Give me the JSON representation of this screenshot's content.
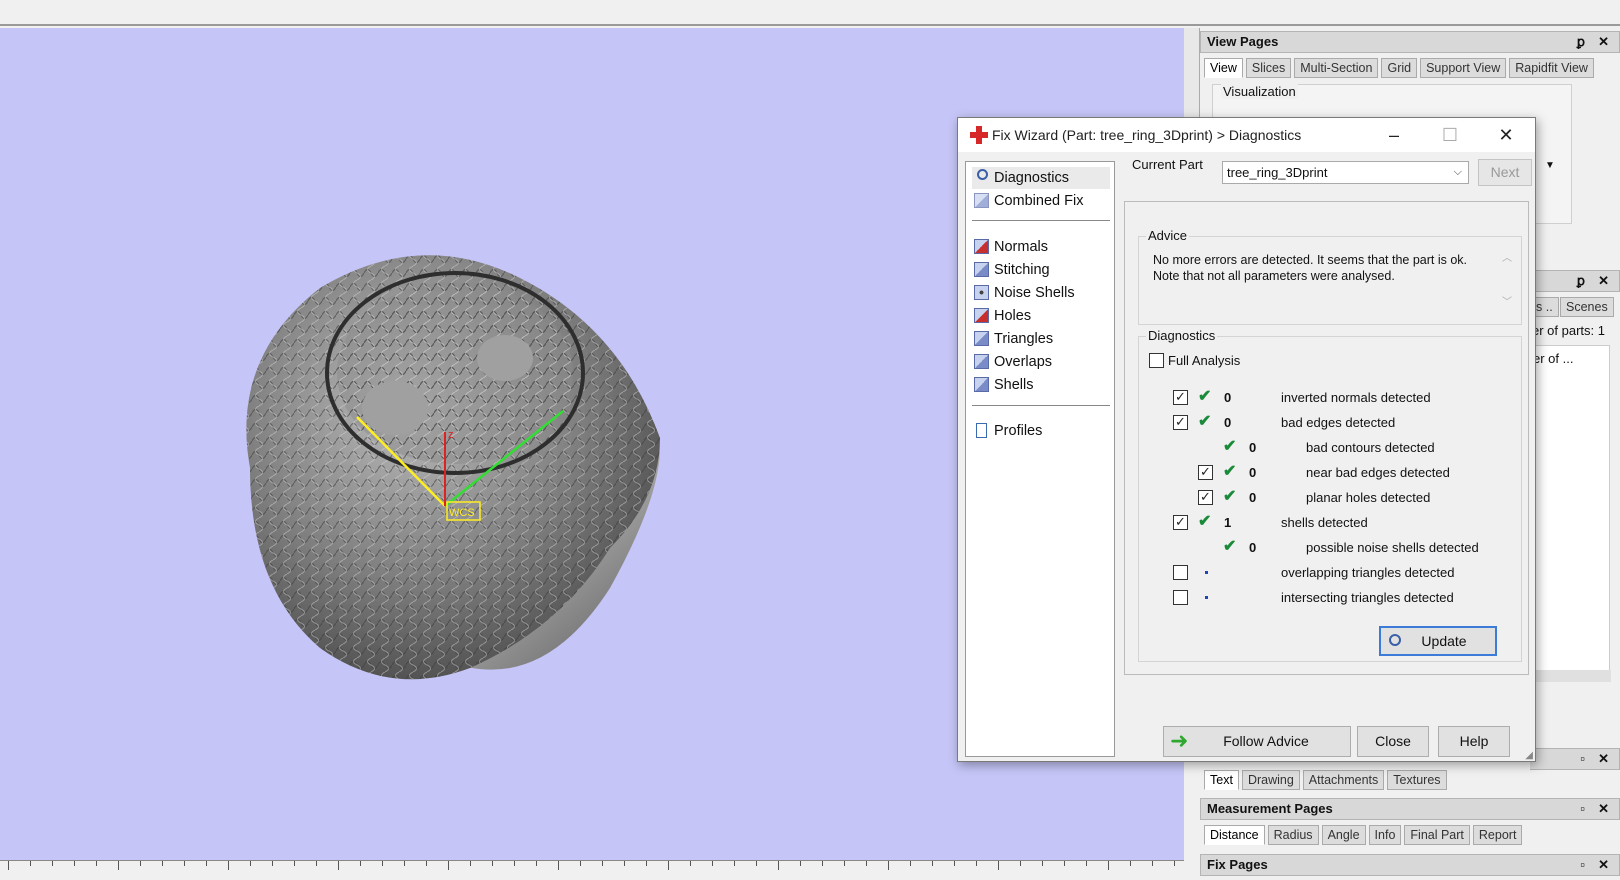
{
  "viewport": {
    "origin_label": "WCS",
    "axis_label": "z"
  },
  "view_pages": {
    "title": "View Pages",
    "tabs": [
      "View",
      "Slices",
      "Multi-Section",
      "Grid",
      "Support View",
      "Rapidfit View"
    ],
    "group_label": "Visualization"
  },
  "parts_panel": {
    "tab_partial": "s ..",
    "tab_scenes": "Scenes",
    "count_text": "er of parts: 1",
    "row_text": "er of ..."
  },
  "annotation_tabs": [
    "Text",
    "Drawing",
    "Attachments",
    "Textures"
  ],
  "measurement_pages": {
    "title": "Measurement Pages",
    "tabs": [
      "Distance",
      "Radius",
      "Angle",
      "Info",
      "Final Part",
      "Report"
    ]
  },
  "fix_pages": {
    "title": "Fix Pages"
  },
  "dialog": {
    "title": "Fix Wizard (Part: tree_ring_3Dprint) > Diagnostics",
    "nav_items": [
      "Diagnostics",
      "Combined Fix"
    ],
    "nav_fix_items": [
      "Normals",
      "Stitching",
      "Noise Shells",
      "Holes",
      "Triangles",
      "Overlaps",
      "Shells"
    ],
    "nav_profiles": "Profiles",
    "current_part_label": "Current Part",
    "current_part_value": "tree_ring_3Dprint",
    "next_label": "Next",
    "advice_title": "Advice",
    "advice_text": "No more errors are detected. It seems that the part is ok. Note that not all parameters were analysed.",
    "diagnostics_title": "Diagnostics",
    "full_analysis_label": "Full Analysis",
    "rows": [
      {
        "count": "0",
        "label": "inverted normals detected"
      },
      {
        "count": "0",
        "label": "bad edges detected"
      },
      {
        "count": "0",
        "label": "bad contours detected"
      },
      {
        "count": "0",
        "label": "near bad edges detected"
      },
      {
        "count": "0",
        "label": "planar holes detected"
      },
      {
        "count": "1",
        "label": "shells detected"
      },
      {
        "count": "0",
        "label": "possible noise shells detected"
      },
      {
        "count": "",
        "label": "overlapping triangles detected"
      },
      {
        "count": "",
        "label": "intersecting triangles detected"
      }
    ],
    "update_label": "Update",
    "follow_advice_label": "Follow Advice",
    "close_label": "Close",
    "help_label": "Help"
  },
  "colors": {
    "viewport_bg": "#c5c5f7",
    "check_green": "#1a8a3a",
    "focus_blue": "#3c7bd8"
  }
}
